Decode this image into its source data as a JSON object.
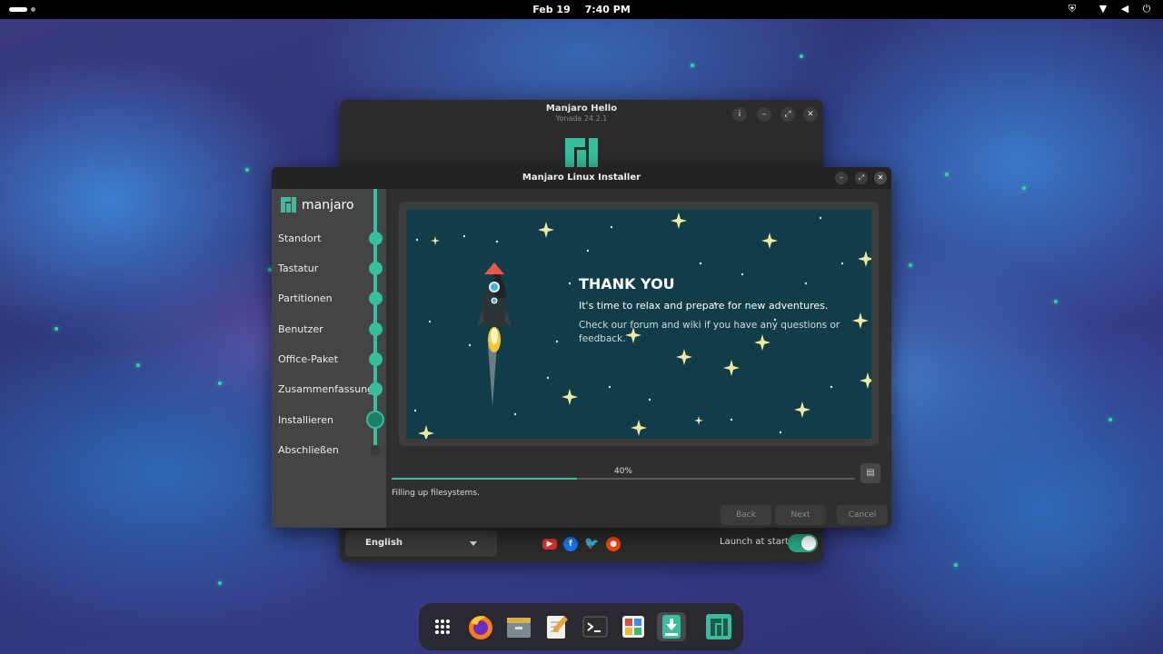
{
  "topbar": {
    "date": "Feb 19",
    "time": "7:40 PM",
    "tray_icons": [
      "shield-icon",
      "wifi-icon",
      "volume-icon",
      "power-icon"
    ]
  },
  "hello_window": {
    "title": "Manjaro Hello",
    "subtitle": "Yonada 24.2.1",
    "language": "English",
    "launch_at_start_label": "Launch at start",
    "launch_at_start": true,
    "social_icons": [
      "youtube-icon",
      "facebook-icon",
      "twitter-icon",
      "reddit-icon"
    ]
  },
  "installer": {
    "title": "Manjaro Linux Installer",
    "brand": "manjaro",
    "steps": [
      {
        "label": "Standort",
        "state": "done"
      },
      {
        "label": "Tastatur",
        "state": "done"
      },
      {
        "label": "Partitionen",
        "state": "done"
      },
      {
        "label": "Benutzer",
        "state": "done"
      },
      {
        "label": "Office-Paket",
        "state": "done"
      },
      {
        "label": "Zusammenfassung",
        "state": "done"
      },
      {
        "label": "Installieren",
        "state": "current"
      },
      {
        "label": "Abschließen",
        "state": "pending"
      }
    ],
    "slide": {
      "title": "THANK YOU",
      "line1": "It's time to relax and prepare for new adventures.",
      "line2": "Check our forum and wiki if you have any questions or feedback."
    },
    "progress_label": "40%",
    "progress": 0.4,
    "status": "Filling up filesystems.",
    "buttons": {
      "back": "Back",
      "next": "Next",
      "cancel": "Cancel"
    }
  },
  "dock": {
    "items": [
      "app-grid-icon",
      "firefox-icon",
      "files-icon",
      "text-editor-icon",
      "terminal-icon",
      "software-icon",
      "installer-icon",
      "manjaro-hello-icon"
    ],
    "active": "installer-icon"
  },
  "colors": {
    "accent": "#35bf9c",
    "slide_bg": "#113d49"
  }
}
